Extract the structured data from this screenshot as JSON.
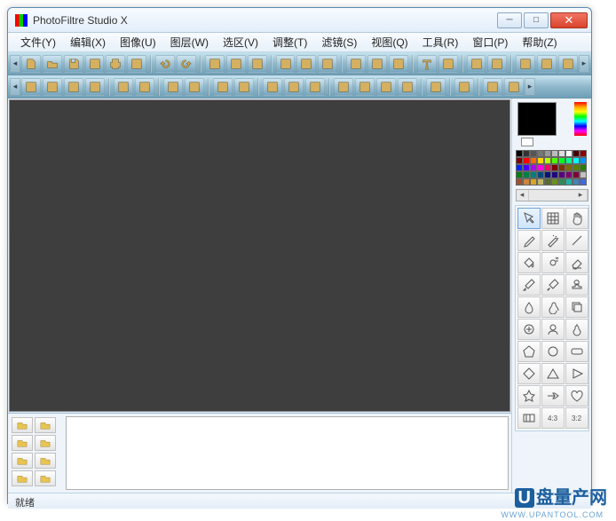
{
  "window": {
    "title": "PhotoFiltre Studio X"
  },
  "menu": [
    {
      "label": "文件(Y)"
    },
    {
      "label": "编辑(X)"
    },
    {
      "label": "图像(U)"
    },
    {
      "label": "图层(W)"
    },
    {
      "label": "选区(V)"
    },
    {
      "label": "调整(T)"
    },
    {
      "label": "滤镜(S)"
    },
    {
      "label": "视图(Q)"
    },
    {
      "label": "工具(R)"
    },
    {
      "label": "窗口(P)"
    },
    {
      "label": "帮助(Z)"
    }
  ],
  "toolbar1": [
    "new",
    "open",
    "save",
    "save-as",
    "print",
    "scan",
    "sep",
    "undo",
    "redo",
    "sep",
    "copy",
    "paste",
    "paste-special",
    "sep",
    "rgb",
    "layers",
    "layers2",
    "sep",
    "nav-back",
    "nav-fwd",
    "fit",
    "sep",
    "text",
    "text2",
    "sep",
    "automate",
    "plugin",
    "sep",
    "module",
    "export",
    "expand"
  ],
  "toolbar2": [
    "brightness-minus",
    "brightness-plus",
    "contrast-minus",
    "contrast-plus",
    "sep",
    "gamma-minus",
    "gamma-plus",
    "sep",
    "sat-minus",
    "sat-plus",
    "sep",
    "hist-minus",
    "hist-plus",
    "sep",
    "gray",
    "auto-gamma",
    "auto-contrast",
    "sep",
    "grid1",
    "grid2",
    "grid3",
    "grid4",
    "sep",
    "mosaic",
    "sep",
    "gradient",
    "sep",
    "blur",
    "noise"
  ],
  "palette_colors": [
    "#000",
    "#333",
    "#555",
    "#777",
    "#999",
    "#bbb",
    "#ddd",
    "#fff",
    "#400",
    "#800",
    "#800000",
    "#ff0000",
    "#ff6a00",
    "#ffd800",
    "#b6ff00",
    "#4cff00",
    "#00ff21",
    "#00ff90",
    "#00ffff",
    "#0094ff",
    "#0026ff",
    "#4800ff",
    "#b200ff",
    "#ff00dc",
    "#ff006e",
    "#7f0000",
    "#7f3300",
    "#7f6a00",
    "#5b7f00",
    "#267f00",
    "#007f0e",
    "#007f46",
    "#007f7f",
    "#004a7f",
    "#00137f",
    "#21007f",
    "#57007f",
    "#7f006e",
    "#7f0037",
    "#c0c0c0",
    "#a0522d",
    "#cd853f",
    "#daa520",
    "#bdb76b",
    "#556b2f",
    "#6b8e23",
    "#2e8b57",
    "#20b2aa",
    "#4682b4",
    "#4169e1"
  ],
  "tools": [
    "pointer",
    "grid-tool",
    "hand",
    "picker",
    "wand",
    "line",
    "fill",
    "spray",
    "eraser",
    "brush",
    "adv-brush",
    "stamp",
    "blur-tool",
    "smudge",
    "clone",
    "heal",
    "portrait",
    "pear",
    "pentagon",
    "circle",
    "rounded",
    "diamond",
    "triangle",
    "play",
    "star",
    "arrow",
    "heart",
    "ratio-any",
    "ratio-43",
    "ratio-32"
  ],
  "ratios": {
    "r1": "4:3",
    "r2": "3:2"
  },
  "layer_btns": [
    "new-layer",
    "dup-layer",
    "merge-down",
    "merge-visible",
    "flatten",
    "save-layer",
    "delete-layer",
    "play-layer"
  ],
  "status": {
    "text": "就绪"
  },
  "watermark": {
    "main": "盘量产网",
    "url": "WWW.UPANTOOL.COM"
  }
}
